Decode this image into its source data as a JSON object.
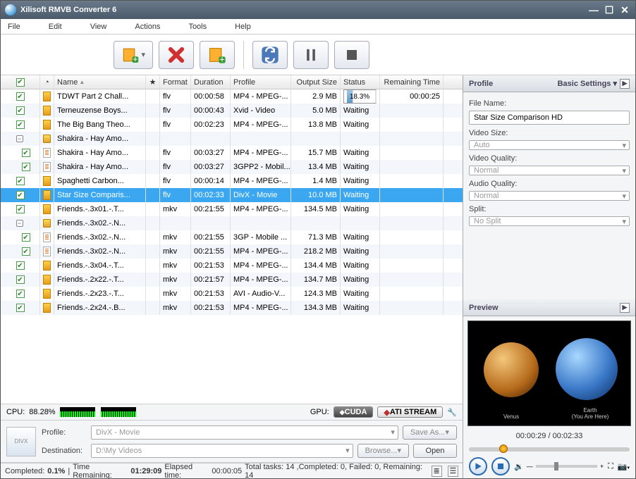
{
  "app_title": "Xilisoft RMVB Converter 6",
  "menu": [
    "File",
    "Edit",
    "View",
    "Actions",
    "Tools",
    "Help"
  ],
  "columns": {
    "name": "Name",
    "format": "Format",
    "duration": "Duration",
    "profile": "Profile",
    "output": "Output Size",
    "status": "Status",
    "remaining": "Remaining Time"
  },
  "rows": [
    {
      "lvl": 0,
      "chk": true,
      "ico": "file",
      "name": "TDWT Part 2 Chall...",
      "fmt": "flv",
      "dur": "00:00:58",
      "prof": "MP4 - MPEG-...",
      "size": "2.9 MB",
      "stat_pct": "18.3%",
      "rem": "00:00:25"
    },
    {
      "lvl": 0,
      "chk": true,
      "ico": "file",
      "name": "Terneuzense Boys...",
      "fmt": "flv",
      "dur": "00:00:43",
      "prof": "Xvid - Video",
      "size": "5.0 MB",
      "stat": "Waiting"
    },
    {
      "lvl": 0,
      "chk": true,
      "ico": "file",
      "name": "The Big Bang Theo...",
      "fmt": "flv",
      "dur": "00:02:23",
      "prof": "MP4 - MPEG-...",
      "size": "13.8 MB",
      "stat": "Waiting"
    },
    {
      "lvl": 0,
      "exp": true,
      "ico": "folder",
      "name": "Shakira - Hay Amo...",
      "fmt": "",
      "dur": "",
      "prof": "",
      "size": "",
      "stat": ""
    },
    {
      "lvl": 1,
      "chk": true,
      "ico": "doc",
      "name": "Shakira - Hay Amo...",
      "fmt": "flv",
      "dur": "00:03:27",
      "prof": "MP4 - MPEG-...",
      "size": "15.7 MB",
      "stat": "Waiting"
    },
    {
      "lvl": 1,
      "chk": true,
      "ico": "doc",
      "name": "Shakira - Hay Amo...",
      "fmt": "flv",
      "dur": "00:03:27",
      "prof": "3GPP2 - Mobil...",
      "size": "13.4 MB",
      "stat": "Waiting"
    },
    {
      "lvl": 0,
      "chk": true,
      "ico": "file",
      "name": "Spaghetti Carbon...",
      "fmt": "flv",
      "dur": "00:00:14",
      "prof": "MP4 - MPEG-...",
      "size": "1.4 MB",
      "stat": "Waiting"
    },
    {
      "lvl": 0,
      "chk": true,
      "ico": "file",
      "name": "Star Size Comparis...",
      "fmt": "flv",
      "dur": "00:02:33",
      "prof": "DivX - Movie",
      "size": "10.0 MB",
      "stat": "Waiting",
      "sel": true
    },
    {
      "lvl": 0,
      "chk": true,
      "ico": "file",
      "name": "Friends.-.3x01.-.T...",
      "fmt": "mkv",
      "dur": "00:21:55",
      "prof": "MP4 - MPEG-...",
      "size": "134.5 MB",
      "stat": "Waiting"
    },
    {
      "lvl": 0,
      "exp": true,
      "ico": "folder",
      "name": "Friends.-.3x02.-.N...",
      "fmt": "",
      "dur": "",
      "prof": "",
      "size": "",
      "stat": ""
    },
    {
      "lvl": 1,
      "chk": true,
      "ico": "doc",
      "name": "Friends.-.3x02.-.N...",
      "fmt": "mkv",
      "dur": "00:21:55",
      "prof": "3GP - Mobile ...",
      "size": "71.3 MB",
      "stat": "Waiting"
    },
    {
      "lvl": 1,
      "chk": true,
      "ico": "doc",
      "name": "Friends.-.3x02.-.N...",
      "fmt": "mkv",
      "dur": "00:21:55",
      "prof": "MP4 - MPEG-...",
      "size": "218.2 MB",
      "stat": "Waiting"
    },
    {
      "lvl": 0,
      "chk": true,
      "ico": "file",
      "name": "Friends.-.3x04.-.T...",
      "fmt": "mkv",
      "dur": "00:21:53",
      "prof": "MP4 - MPEG-...",
      "size": "134.4 MB",
      "stat": "Waiting"
    },
    {
      "lvl": 0,
      "chk": true,
      "ico": "file",
      "name": "Friends.-.2x22.-.T...",
      "fmt": "mkv",
      "dur": "00:21:57",
      "prof": "MP4 - MPEG-...",
      "size": "134.7 MB",
      "stat": "Waiting"
    },
    {
      "lvl": 0,
      "chk": true,
      "ico": "file",
      "name": "Friends.-.2x23.-.T...",
      "fmt": "mkv",
      "dur": "00:21:53",
      "prof": "AVI - Audio-V...",
      "size": "124.3 MB",
      "stat": "Waiting"
    },
    {
      "lvl": 0,
      "chk": true,
      "ico": "file",
      "name": "Friends.-.2x24.-.B...",
      "fmt": "mkv",
      "dur": "00:21:53",
      "prof": "MP4 - MPEG-...",
      "size": "134.3 MB",
      "stat": "Waiting"
    }
  ],
  "cpu": {
    "label": "CPU:",
    "pct": "88.28%"
  },
  "gpu": {
    "label": "GPU:",
    "cuda": "CUDA",
    "ati": "ATI STREAM"
  },
  "output": {
    "profile_lbl": "Profile:",
    "profile_val": "DivX - Movie",
    "dest_lbl": "Destination:",
    "dest_val": "D:\\My Videos",
    "saveas": "Save As...",
    "browse": "Browse...",
    "open": "Open"
  },
  "status": {
    "completed_lbl": "Completed:",
    "completed": "0.1%",
    "time_rem_lbl": "Time Remaining:",
    "time_rem": "01:29:09",
    "elapsed_lbl": "Elapsed time:",
    "elapsed": "00:00:05",
    "tasks": "Total tasks: 14 ,Completed: 0, Failed: 0, Remaining: 14"
  },
  "profile_panel": {
    "title": "Profile",
    "settings": "Basic Settings",
    "filename_lbl": "File Name:",
    "filename": "Star Size Comparison HD",
    "vsize_lbl": "Video Size:",
    "vsize": "Auto",
    "vq_lbl": "Video Quality:",
    "vq": "Normal",
    "aq_lbl": "Audio Quality:",
    "aq": "Normal",
    "split_lbl": "Split:",
    "split": "No Split"
  },
  "preview": {
    "title": "Preview",
    "time": "00:00:29 / 00:02:33",
    "p1": "Venus",
    "p2": "Earth\n(You Are Here)"
  }
}
